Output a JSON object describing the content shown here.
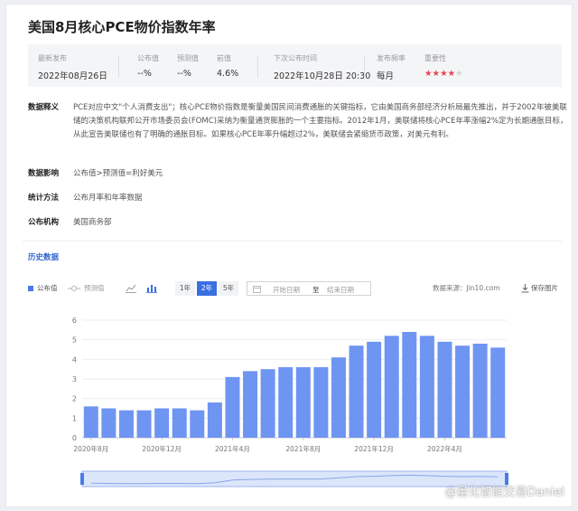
{
  "title": "美国8月核心PCE物价指数年率",
  "summary": {
    "latest_label": "最新发布",
    "latest_value": "2022年08月26日",
    "actual_label": "公布值",
    "actual_value": "--%",
    "forecast_label": "预测值",
    "forecast_value": "--%",
    "previous_label": "前值",
    "previous_value": "4.6%",
    "next_label": "下次公布时间",
    "next_value": "2022年10月28日 20:30",
    "freq_label": "发布频率",
    "freq_value": "每月",
    "importance_label": "重要性",
    "importance_stars": 4,
    "importance_max": 5
  },
  "details": {
    "definition_label": "数据释义",
    "definition_text": "PCE对应中文\"个人消费支出\"；核心PCE物价指数是衡量美国民间消费通胀的关键指标，它由美国商务部经济分析局最先推出，并于2002年被美联储的决策机构联邦公开市场委员会(FOMC)采纳为衡量通货膨胀的一个主要指标。2012年1月，美联储将核心PCE年率涨幅2%定为长期通胀目标，从此宣告美联储也有了明确的通胀目标。如果核心PCE年率升幅超过2%，美联储会紧缩货币政策，对美元有利。",
    "impact_label": "数据影响",
    "impact_text": "公布值>预测值=利好美元",
    "method_label": "统计方法",
    "method_text": "公布月率和年率数据",
    "agency_label": "公布机构",
    "agency_text": "美国商务部"
  },
  "history_label": "历史数据",
  "toolbar": {
    "legend_actual": "公布值",
    "legend_forecast": "预测值",
    "range_buttons": [
      "1年",
      "2年",
      "5年"
    ],
    "active_range": "2年",
    "start_placeholder": "开始日期",
    "to_label": "至",
    "end_placeholder": "结束日期",
    "source": "数据来源：Jin10.com",
    "save_label": "保存图片"
  },
  "colors": {
    "bar": "#6f95f2",
    "accent": "#3a6fe0",
    "star": "#e8434e"
  },
  "chart_data": {
    "type": "bar",
    "xlabels": [
      "2020年8月",
      "2020年12月",
      "2021年4月",
      "2021年8月",
      "2021年12月",
      "2022年4月"
    ],
    "x": [
      "2020-08",
      "2020-09",
      "2020-10",
      "2020-11",
      "2020-12",
      "2021-01",
      "2021-02",
      "2021-03",
      "2021-04",
      "2021-05",
      "2021-06",
      "2021-07",
      "2021-08",
      "2021-09",
      "2021-10",
      "2021-11",
      "2021-12",
      "2022-01",
      "2022-02",
      "2022-03",
      "2022-04",
      "2022-05",
      "2022-06",
      "2022-07"
    ],
    "values": [
      1.6,
      1.5,
      1.4,
      1.4,
      1.5,
      1.5,
      1.4,
      1.8,
      3.1,
      3.4,
      3.5,
      3.6,
      3.6,
      3.6,
      4.1,
      4.7,
      4.9,
      5.2,
      5.4,
      5.2,
      4.9,
      4.7,
      4.8,
      4.6
    ],
    "yticks": [
      0,
      1,
      2,
      3,
      4,
      5,
      6
    ],
    "ylim": [
      0,
      6
    ],
    "grid": true
  },
  "watermark": "@量化智能交易Daniel"
}
